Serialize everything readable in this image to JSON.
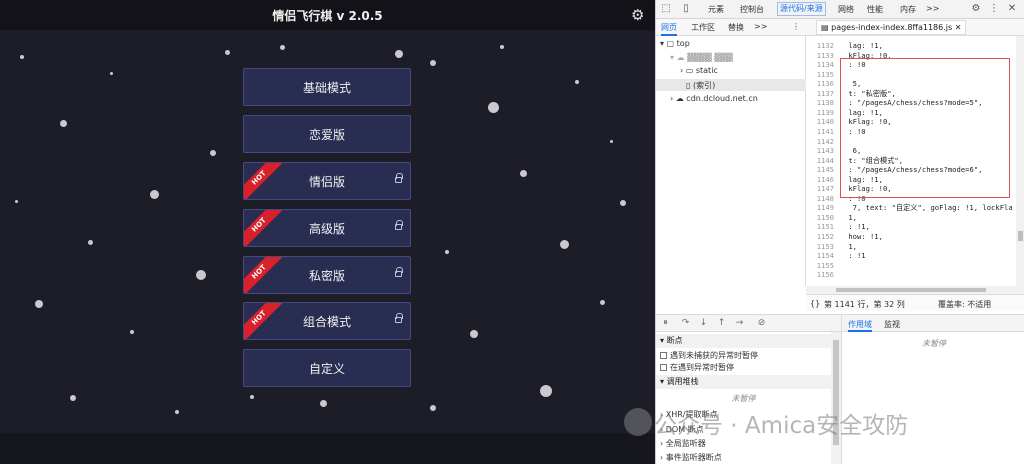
{
  "game": {
    "title": "情侣飞行棋 v 2.0.5",
    "gear_icon": "gear-icon",
    "hot_label": "HOT",
    "modes": [
      {
        "label": "基础模式",
        "hot": false,
        "locked": false
      },
      {
        "label": "恋爱版",
        "hot": false,
        "locked": false
      },
      {
        "label": "情侣版",
        "hot": true,
        "locked": true
      },
      {
        "label": "高级版",
        "hot": true,
        "locked": true
      },
      {
        "label": "私密版",
        "hot": true,
        "locked": true
      },
      {
        "label": "组合模式",
        "hot": true,
        "locked": true
      },
      {
        "label": "自定义",
        "hot": false,
        "locked": false
      }
    ]
  },
  "devtools": {
    "tabs": [
      "元素",
      "控制台",
      "源代码/来源",
      "网络",
      "性能",
      "内存",
      ">>"
    ],
    "active_tab": "源代码/来源",
    "subtabs": [
      "网页",
      "工作区",
      "替换",
      ">>"
    ],
    "file_tab": "pages-index-index.8ffa1186.js",
    "tree": {
      "top": "top",
      "static": "static",
      "index": "(索引)",
      "cdn": "cdn.dcloud.net.cn"
    },
    "code_lines": [
      {
        "n": "1132",
        "t": " lag: !1,"
      },
      {
        "n": "1133",
        "t": " kFlag: !0,"
      },
      {
        "n": "1134",
        "t": " : !0"
      },
      {
        "n": "1135",
        "t": ""
      },
      {
        "n": "1136",
        "t": "  5,"
      },
      {
        "n": "1137",
        "t": " t: \"私密版\","
      },
      {
        "n": "1138",
        "t": " : \"/pagesA/chess/chess?mode=5\","
      },
      {
        "n": "1139",
        "t": " lag: !1,"
      },
      {
        "n": "1140",
        "t": " kFlag: !0,"
      },
      {
        "n": "1141",
        "t": " : !0"
      },
      {
        "n": "1142",
        "t": ""
      },
      {
        "n": "1143",
        "t": "  6,"
      },
      {
        "n": "1144",
        "t": " t: \"组合模式\","
      },
      {
        "n": "1145",
        "t": " : \"/pagesA/chess/chess?mode=6\","
      },
      {
        "n": "1146",
        "t": " lag: !1,"
      },
      {
        "n": "1147",
        "t": " kFlag: !0,"
      },
      {
        "n": "1148",
        "t": " : !0"
      },
      {
        "n": "1149",
        "t": "  7, text: \"自定义\", goFlag: !1, lockFla"
      },
      {
        "n": "1150",
        "t": " 1,"
      },
      {
        "n": "1151",
        "t": " : !1,"
      },
      {
        "n": "1152",
        "t": " how: !1,"
      },
      {
        "n": "1153",
        "t": " 1,"
      },
      {
        "n": "1154",
        "t": " : !1"
      },
      {
        "n": "1155",
        "t": ""
      },
      {
        "n": "1156",
        "t": ""
      }
    ],
    "status": {
      "position": "第 1141 行，第 32 列",
      "coverage": "覆盖率: 不适用"
    },
    "scope_tabs": [
      "作用域",
      "监视"
    ],
    "not_paused": "未暂停",
    "breakpoints": {
      "title": "断点",
      "opt1": "遇到未捕获的异常时暂停",
      "opt2": "在遇到异常时暂停",
      "callstack": "调用堆栈",
      "xhr": "XHR/提取断点",
      "dom": "DOM 断点",
      "global": "全局监听器",
      "event": "事件监听器断点"
    }
  },
  "watermark": "公众号 · Amica安全攻防"
}
